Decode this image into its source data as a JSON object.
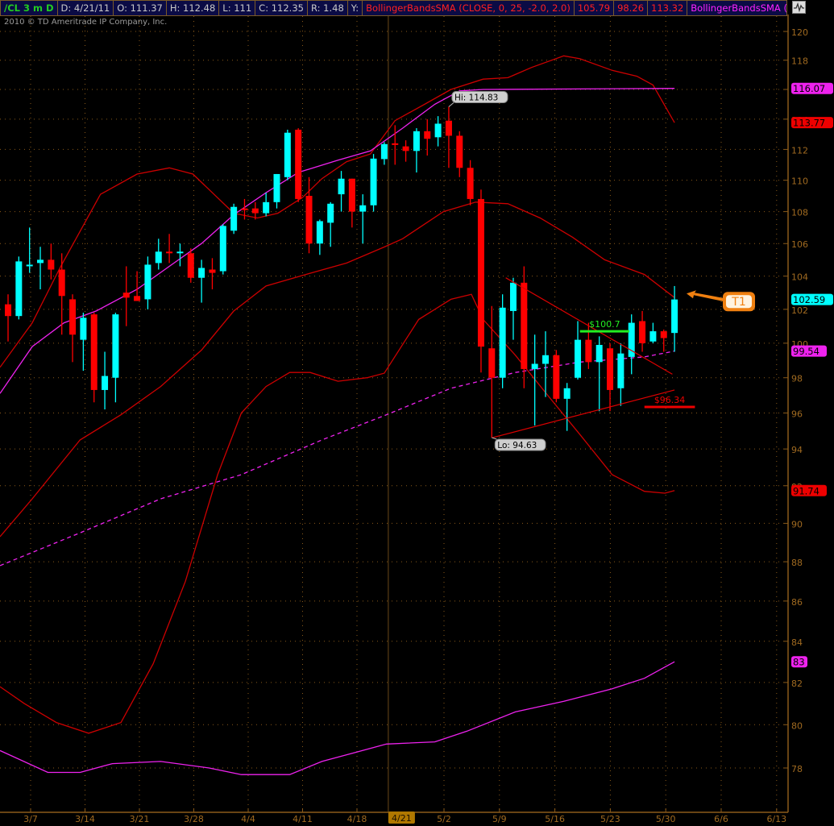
{
  "header": {
    "symbol": "/CL 3 m D",
    "date": "D: 4/21/11",
    "open": "O: 111.37",
    "high": "H: 112.48",
    "low": "L: 111",
    "close": "C: 112.35",
    "range": "R: 1.48",
    "y": "Y:",
    "study1": "BollingerBandsSMA (CLOSE, 0, 25, -2.0, 2.0)",
    "study1_mid": "105.79",
    "study1_low": "98.26",
    "study1_up": "113.32",
    "study2": "BollingerBandsSMA (CLOSE, 0..."
  },
  "copyright": "2010 © TD Ameritrade IP Company, Inc.",
  "colors": {
    "up": "#00ffff",
    "down": "#ff0000",
    "band1": "#cc0000",
    "band2": "#ee22ee",
    "grid": "#8a5a1a",
    "bg": "#000000"
  },
  "chart_data": {
    "type": "candlestick",
    "symbol": "/CL",
    "y_scale": "log",
    "ylim": [
      76.5,
      121
    ],
    "y_ticks": [
      120,
      118,
      116,
      114,
      112,
      110,
      108,
      106,
      104,
      102,
      100,
      98,
      96,
      94,
      92,
      90,
      88,
      86,
      84,
      82,
      80,
      78
    ],
    "x_ticks": [
      "3/7",
      "3/14",
      "3/21",
      "3/28",
      "4/4",
      "4/11",
      "4/18",
      "5/2",
      "5/9",
      "5/16",
      "5/23",
      "5/30",
      "6/6",
      "6/13"
    ],
    "cursor_date": "4/21",
    "cursor_index": 35,
    "candles": [
      [
        102.3,
        102.9,
        100.1,
        101.6
      ],
      [
        101.6,
        105.2,
        101.4,
        104.9
      ],
      [
        104.6,
        107.0,
        104.2,
        104.7
      ],
      [
        104.8,
        105.8,
        103.2,
        105.0
      ],
      [
        105.0,
        106.0,
        103.8,
        104.4
      ],
      [
        104.4,
        105.4,
        100.5,
        102.8
      ],
      [
        102.6,
        102.9,
        98.9,
        100.5
      ],
      [
        100.2,
        101.8,
        98.4,
        101.5
      ],
      [
        101.7,
        101.8,
        96.6,
        97.3
      ],
      [
        97.3,
        99.5,
        96.2,
        98.1
      ],
      [
        98.0,
        101.8,
        96.6,
        101.7
      ],
      [
        103.0,
        104.6,
        101.0,
        102.7
      ],
      [
        102.8,
        104.3,
        102.5,
        102.5
      ],
      [
        102.6,
        105.2,
        102.0,
        104.7
      ],
      [
        104.8,
        106.3,
        104.4,
        105.5
      ],
      [
        105.5,
        106.6,
        104.8,
        105.4
      ],
      [
        105.4,
        106.0,
        104.6,
        105.5
      ],
      [
        105.4,
        105.7,
        103.6,
        103.9
      ],
      [
        103.9,
        105.0,
        102.4,
        104.5
      ],
      [
        104.4,
        105.1,
        103.2,
        104.2
      ],
      [
        104.3,
        107.2,
        104.1,
        107.1
      ],
      [
        106.8,
        108.5,
        106.6,
        108.3
      ],
      [
        108.2,
        108.8,
        107.5,
        108.1
      ],
      [
        108.2,
        108.6,
        107.5,
        107.9
      ],
      [
        107.9,
        109.2,
        107.7,
        108.6
      ],
      [
        108.6,
        110.4,
        108.2,
        110.4
      ],
      [
        110.2,
        113.3,
        110.0,
        113.1
      ],
      [
        113.3,
        113.4,
        108.6,
        108.8
      ],
      [
        109.0,
        110.2,
        105.4,
        106.0
      ],
      [
        106.0,
        107.5,
        105.3,
        107.4
      ],
      [
        107.3,
        108.6,
        105.8,
        108.5
      ],
      [
        109.1,
        110.6,
        108.0,
        110.1
      ],
      [
        110.1,
        110.1,
        107.0,
        108.0
      ],
      [
        108.0,
        109.1,
        106.0,
        108.4
      ],
      [
        108.4,
        111.7,
        108.0,
        111.4
      ],
      [
        111.37,
        112.48,
        111.0,
        112.35
      ],
      [
        112.4,
        113.6,
        111.0,
        112.3
      ],
      [
        112.2,
        112.6,
        111.2,
        111.9
      ],
      [
        111.9,
        113.4,
        110.5,
        113.2
      ],
      [
        113.2,
        114.0,
        111.6,
        112.7
      ],
      [
        112.8,
        114.2,
        112.2,
        113.7
      ],
      [
        113.9,
        114.83,
        110.8,
        112.9
      ],
      [
        112.9,
        113.2,
        110.2,
        110.8
      ],
      [
        110.8,
        111.3,
        108.4,
        108.8
      ],
      [
        108.8,
        109.4,
        98.3,
        99.8
      ],
      [
        99.7,
        102.2,
        94.63,
        98.0
      ],
      [
        98.0,
        102.9,
        97.4,
        102.1
      ],
      [
        101.9,
        103.9,
        100.2,
        103.6
      ],
      [
        103.6,
        104.6,
        97.4,
        98.5
      ],
      [
        98.5,
        100.5,
        95.3,
        98.8
      ],
      [
        98.8,
        100.7,
        96.9,
        99.3
      ],
      [
        99.3,
        99.6,
        96.6,
        96.8
      ],
      [
        96.8,
        97.7,
        95.0,
        97.4
      ],
      [
        98.0,
        101.3,
        97.9,
        100.2
      ],
      [
        100.2,
        101.2,
        98.5,
        98.9
      ],
      [
        98.9,
        100.4,
        96.1,
        99.9
      ],
      [
        99.7,
        100.0,
        96.1,
        97.3
      ],
      [
        97.4,
        100.0,
        96.4,
        99.4
      ],
      [
        99.2,
        101.7,
        98.2,
        101.2
      ],
      [
        101.3,
        101.9,
        99.5,
        100.0
      ],
      [
        100.1,
        101.2,
        100.0,
        100.7
      ],
      [
        100.7,
        100.8,
        99.5,
        100.3
      ],
      [
        100.6,
        103.4,
        99.5,
        102.59
      ]
    ],
    "series": [
      {
        "name": "BB25 upper",
        "color": "#cc0000",
        "dashed": false,
        "points": [
          [
            -0.75,
            98.6
          ],
          [
            2.25,
            101.2
          ],
          [
            4.9,
            104.6
          ],
          [
            8.6,
            109.1
          ],
          [
            12,
            110.4
          ],
          [
            15,
            110.8
          ],
          [
            17.2,
            110.4
          ],
          [
            21,
            107.9
          ],
          [
            23.2,
            107.6
          ],
          [
            25.1,
            107.9
          ],
          [
            27.4,
            108.9
          ],
          [
            29.2,
            110.1
          ],
          [
            31.5,
            111.2
          ],
          [
            33.7,
            111.7
          ],
          [
            36,
            113.9
          ],
          [
            39,
            115.1
          ],
          [
            41.2,
            116
          ],
          [
            44.2,
            116.7
          ],
          [
            46.5,
            116.8
          ],
          [
            48.7,
            117.5
          ],
          [
            51.7,
            118.3
          ],
          [
            53.2,
            118.1
          ],
          [
            56.2,
            117.3
          ],
          [
            58.5,
            116.9
          ],
          [
            60,
            116.3
          ],
          [
            62,
            113.77
          ]
        ]
      },
      {
        "name": "BB25 middle",
        "color": "#cc0000",
        "dashed": false,
        "points": [
          [
            -0.75,
            89.3
          ],
          [
            2.25,
            91.3
          ],
          [
            6.7,
            94.5
          ],
          [
            10.5,
            95.9
          ],
          [
            14.2,
            97.5
          ],
          [
            18,
            99.6
          ],
          [
            21,
            101.9
          ],
          [
            24,
            103.4
          ],
          [
            27.7,
            104.1
          ],
          [
            31.5,
            104.8
          ],
          [
            35,
            105.79
          ],
          [
            36.7,
            106.3
          ],
          [
            40.5,
            108
          ],
          [
            43.5,
            108.6
          ],
          [
            46.5,
            108.5
          ],
          [
            49.5,
            107.6
          ],
          [
            52.5,
            106.4
          ],
          [
            55.5,
            105
          ],
          [
            59.2,
            104.1
          ],
          [
            62,
            102.7
          ]
        ]
      },
      {
        "name": "BB25 lower",
        "color": "#cc0000",
        "dashed": false,
        "points": [
          [
            -0.75,
            81.8
          ],
          [
            1.5,
            81
          ],
          [
            4.5,
            80.1
          ],
          [
            7.5,
            79.6
          ],
          [
            10.5,
            80.1
          ],
          [
            13.5,
            82.9
          ],
          [
            16.5,
            87
          ],
          [
            19.5,
            92.6
          ],
          [
            21.7,
            96
          ],
          [
            24,
            97.5
          ],
          [
            26.2,
            98.3
          ],
          [
            28.1,
            98.3
          ],
          [
            30.7,
            97.8
          ],
          [
            33.4,
            98
          ],
          [
            35,
            98.26
          ],
          [
            38.2,
            101.4
          ],
          [
            41.2,
            102.6
          ],
          [
            43.1,
            102.9
          ],
          [
            44.2,
            101.4
          ],
          [
            47.2,
            99.3
          ],
          [
            50.2,
            97
          ],
          [
            53.2,
            94.8
          ],
          [
            56.2,
            92.6
          ],
          [
            59.2,
            91.7
          ],
          [
            61.1,
            91.6
          ],
          [
            62,
            91.74
          ]
        ]
      },
      {
        "name": "BB upper 2",
        "color": "#ee22ee",
        "dashed": false,
        "points": [
          [
            -0.75,
            97.1
          ],
          [
            2.25,
            99.8
          ],
          [
            5.2,
            101.2
          ],
          [
            8.2,
            101.9
          ],
          [
            12,
            103.2
          ],
          [
            15,
            104.6
          ],
          [
            18,
            106
          ],
          [
            21,
            107.8
          ],
          [
            24,
            109.2
          ],
          [
            27,
            110.5
          ],
          [
            30.7,
            111.3
          ],
          [
            33.7,
            111.9
          ],
          [
            36.7,
            113.4
          ],
          [
            39.7,
            115
          ],
          [
            42,
            115.9
          ],
          [
            44.2,
            116
          ],
          [
            62,
            116.07
          ]
        ]
      },
      {
        "name": "BB middle 2",
        "color": "#ee22ee",
        "dashed": true,
        "points": [
          [
            -0.75,
            87.8
          ],
          [
            6.7,
            89.5
          ],
          [
            14.2,
            91.3
          ],
          [
            21.7,
            92.6
          ],
          [
            29.2,
            94.5
          ],
          [
            35.2,
            95.9
          ],
          [
            41.2,
            97.4
          ],
          [
            47.2,
            98.3
          ],
          [
            53.2,
            98.9
          ],
          [
            59.2,
            99.2
          ],
          [
            62,
            99.54
          ]
        ]
      },
      {
        "name": "BB lower 2",
        "color": "#ee22ee",
        "dashed": false,
        "points": [
          [
            -0.75,
            78.8
          ],
          [
            3.7,
            77.8
          ],
          [
            6.7,
            77.8
          ],
          [
            9.7,
            78.2
          ],
          [
            14.2,
            78.3
          ],
          [
            18.7,
            78
          ],
          [
            21.7,
            77.7
          ],
          [
            26.2,
            77.7
          ],
          [
            29.2,
            78.3
          ],
          [
            32.2,
            78.7
          ],
          [
            35.2,
            79.1
          ],
          [
            39.7,
            79.2
          ],
          [
            42.7,
            79.7
          ],
          [
            47.2,
            80.6
          ],
          [
            51.7,
            81.1
          ],
          [
            56.2,
            81.7
          ],
          [
            59.2,
            82.2
          ],
          [
            62,
            83
          ]
        ]
      }
    ],
    "price_badges": [
      {
        "text": "116.07",
        "value": 116.07,
        "bg": "#ee22ee"
      },
      {
        "text": "113.77",
        "value": 113.77,
        "bg": "#ee0000"
      },
      {
        "text": "102.59",
        "value": 102.59,
        "bg": "#00ffff"
      },
      {
        "text": "99.54",
        "value": 99.54,
        "bg": "#ee22ee"
      },
      {
        "text": "91.74",
        "value": 91.74,
        "bg": "#ee0000"
      },
      {
        "text": "83",
        "value": 83,
        "bg": "#ee22ee"
      }
    ],
    "annotations": {
      "hi_label": "Hi: 114.83",
      "hi_index": 41,
      "hi_value": 114.83,
      "lo_label": "Lo: 94.63",
      "lo_index": 45,
      "lo_value": 94.63,
      "trend_upper": [
        [
          46.3,
          103.9
        ],
        [
          61.8,
          98.2
        ]
      ],
      "trend_lower": [
        [
          45.1,
          94.63
        ],
        [
          62,
          97.3
        ]
      ],
      "level_green": {
        "label": "$100.7",
        "value": 100.7,
        "from": 53.2,
        "to": 57.8,
        "color": "#22ee22"
      },
      "level_red": {
        "label": "$96.34",
        "value": 96.34,
        "from": 59.2,
        "to": 63.9,
        "color": "#ee0000"
      },
      "callout": {
        "label": "T1",
        "value": 102.9,
        "color": "#f08010"
      }
    }
  }
}
